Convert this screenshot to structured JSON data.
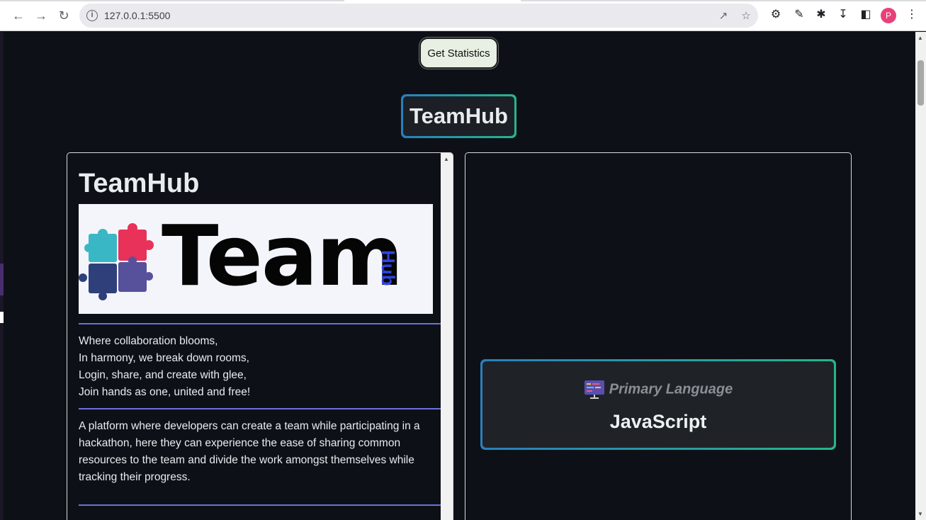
{
  "browser": {
    "url": "127.0.0.1:5500",
    "profile_initial": "P"
  },
  "header": {
    "stats_button": "Get Statistics",
    "title": "TeamHub"
  },
  "left_card": {
    "heading": "TeamHub",
    "logo_alt": "Team Hub logo",
    "logo_word": "Team",
    "logo_sub": "Hub",
    "poem": [
      "Where collaboration blooms,",
      "In harmony, we break down rooms,",
      "Login, share, and create with glee,",
      "Join hands as one, united and free!"
    ],
    "description": "A platform where developers can create a team while participating in a hackathon, here they can experience the ease of sharing common resources to the team and divide the work amongst themselves while tracking their progress."
  },
  "right_card": {
    "language_label": "Primary Language",
    "language_value": "JavaScript"
  },
  "colors": {
    "background": "#0d1117",
    "accent_gradient_start": "#2a7fbd",
    "accent_gradient_end": "#27b58a",
    "divider": "#6a72d8"
  }
}
